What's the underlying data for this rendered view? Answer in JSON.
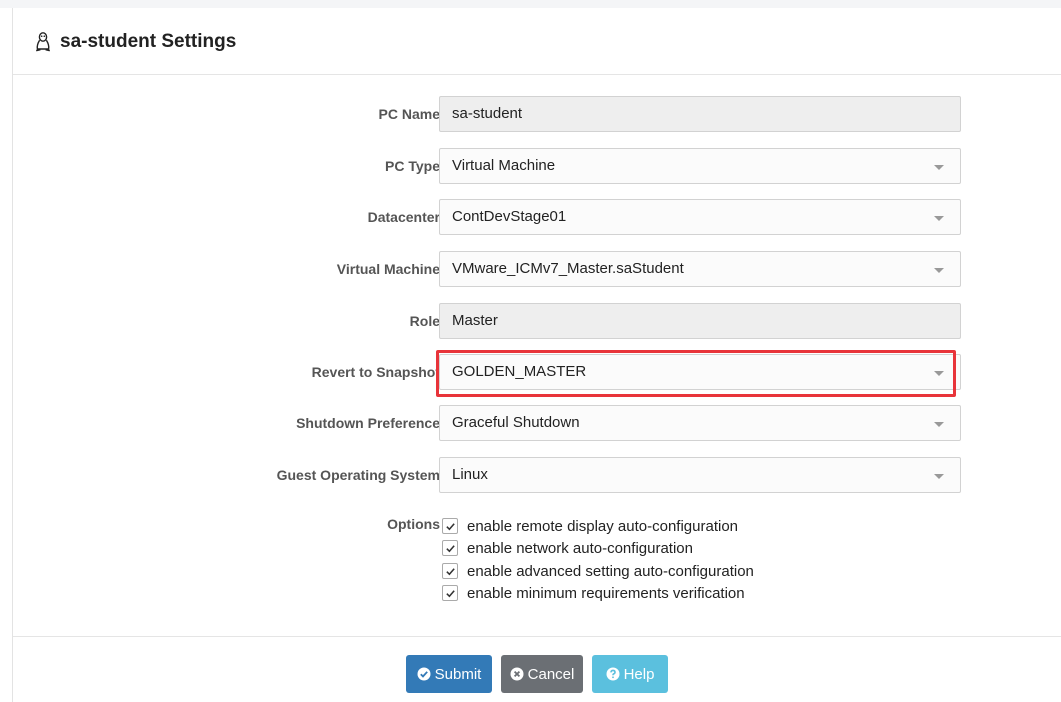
{
  "header": {
    "title": "sa-student Settings",
    "icon": "linux-icon"
  },
  "form": {
    "pc_name": {
      "label": "PC Name",
      "value": "sa-student"
    },
    "pc_type": {
      "label": "PC Type",
      "value": "Virtual Machine"
    },
    "datacenter": {
      "label": "Datacenter",
      "value": "ContDevStage01"
    },
    "virtual_machine": {
      "label": "Virtual Machine",
      "value": "VMware_ICMv7_Master.saStudent"
    },
    "role": {
      "label": "Role",
      "value": "Master"
    },
    "revert_snapshot": {
      "label": "Revert to Snapshot",
      "value": "GOLDEN_MASTER"
    },
    "shutdown_preference": {
      "label": "Shutdown Preference",
      "value": "Graceful Shutdown"
    },
    "guest_os": {
      "label": "Guest Operating System",
      "value": "Linux"
    },
    "options": {
      "label": "Options",
      "items": [
        {
          "text": "enable remote display auto-configuration",
          "checked": true
        },
        {
          "text": "enable network auto-configuration",
          "checked": true
        },
        {
          "text": "enable advanced setting auto-configuration",
          "checked": true
        },
        {
          "text": "enable minimum requirements verification",
          "checked": true
        }
      ]
    }
  },
  "buttons": {
    "submit": "Submit",
    "cancel": "Cancel",
    "help": "Help"
  },
  "colors": {
    "highlight": "#e8343a",
    "submit": "#337ab7",
    "cancel": "#6b6f74",
    "help": "#5bc0de"
  }
}
